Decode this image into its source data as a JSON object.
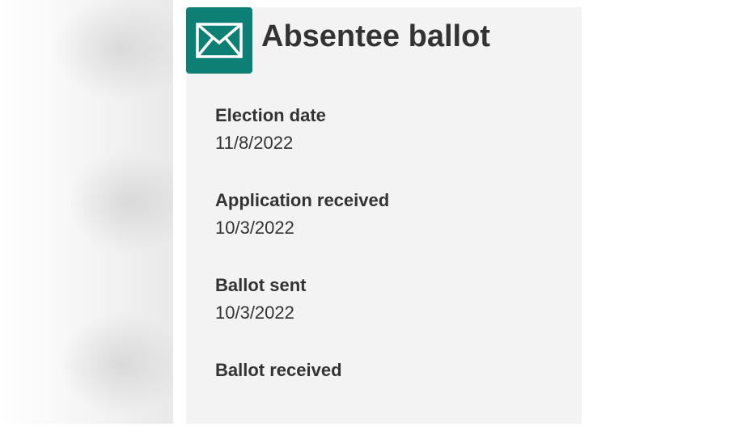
{
  "header": {
    "icon": "envelope-icon",
    "title": "Absentee ballot"
  },
  "fields": [
    {
      "label": "Election date",
      "value": "11/8/2022"
    },
    {
      "label": "Application received",
      "value": "10/3/2022"
    },
    {
      "label": "Ballot sent",
      "value": "10/3/2022"
    },
    {
      "label": "Ballot received",
      "value": ""
    }
  ],
  "colors": {
    "accent": "#0e7f74",
    "card_background": "#f3f3f3",
    "text": "#333333"
  }
}
